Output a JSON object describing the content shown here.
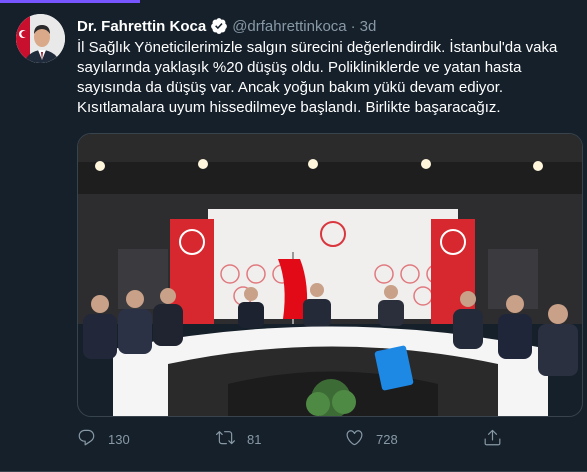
{
  "tweet": {
    "author_name": "Dr. Fahrettin Koca",
    "handle": "@drfahrettinkoca",
    "separator": "·",
    "time": "3d",
    "text": "İl Sağlık Yöneticilerimizle salgın sürecini değerlendirdik. İstanbul'da vaka sayılarında yaklaşık %20 düşüş oldu. Polikliniklerde ve yatan hasta sayısında da düşüş var. Ancak yoğun bakım yükü devam ediyor. Kısıtlamalara uyum hissedilmeye başlandı. Birlikte başaracağız.",
    "actions": {
      "reply_count": "130",
      "retweet_count": "81",
      "like_count": "728"
    }
  },
  "icons": {
    "verified": "verified-badge-icon",
    "reply": "reply-icon",
    "retweet": "retweet-icon",
    "like": "like-icon",
    "share": "share-icon"
  },
  "colors": {
    "background": "#15202b",
    "secondary_text": "#8899a6",
    "accent": "#1da1f2",
    "banner_red": "#d6282e",
    "flag_red": "#e30a17"
  }
}
